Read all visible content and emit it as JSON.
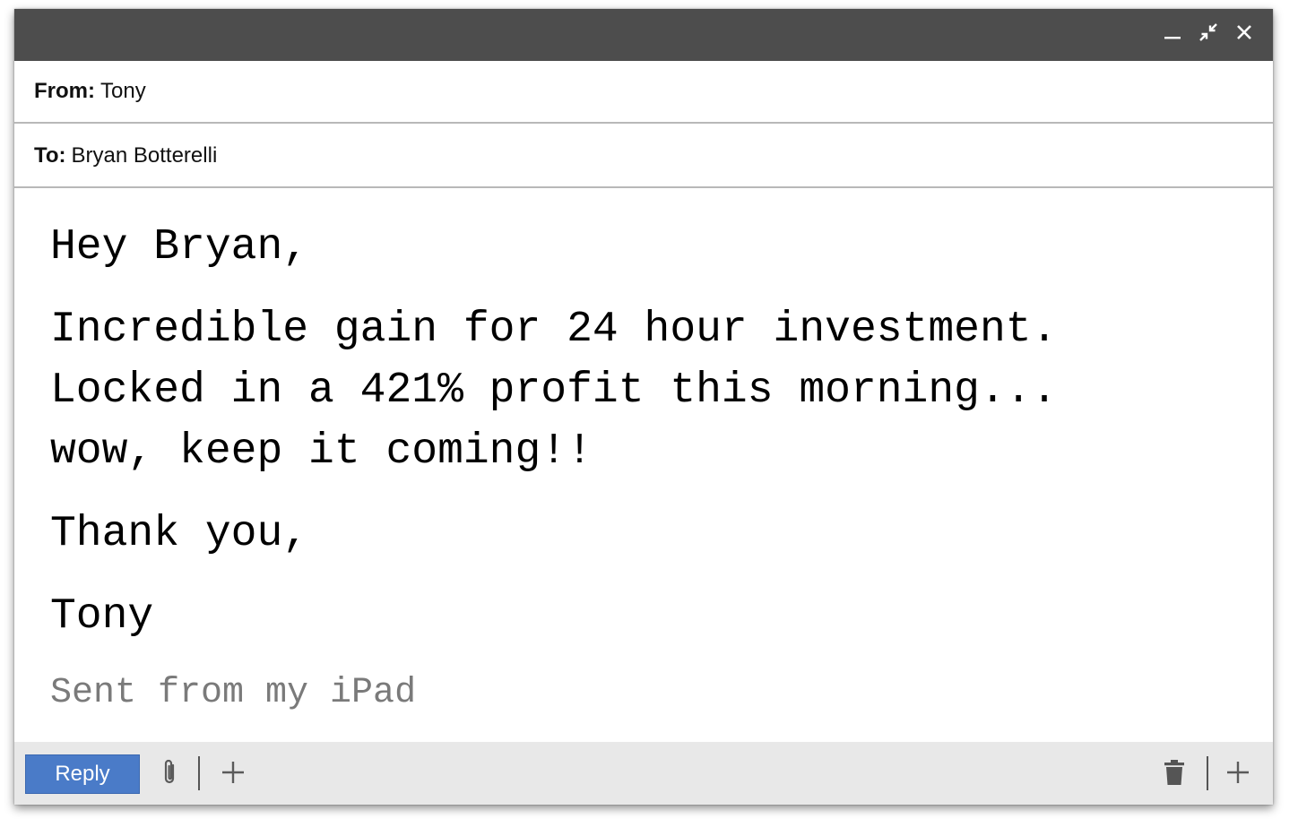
{
  "header": {
    "from_label": "From:",
    "from_value": "Tony",
    "to_label": "To:",
    "to_value": "Bryan Botterelli"
  },
  "message": {
    "greeting": "Hey Bryan,",
    "line1": "Incredible gain for 24 hour investment.",
    "line2": "Locked in a 421% profit this morning...",
    "line3": "wow, keep it coming!!",
    "closing": "Thank you,",
    "signature": "Tony",
    "footer": "Sent from my iPad"
  },
  "toolbar": {
    "reply_label": "Reply"
  },
  "icons": {
    "minimize": "minimize-icon",
    "restore": "restore-icon",
    "close": "close-icon",
    "attach": "paperclip-icon",
    "add": "plus-icon",
    "delete": "trash-icon"
  },
  "colors": {
    "titlebar": "#4d4d4d",
    "reply_button": "#4a7bc8",
    "toolbar": "#e8e8e8",
    "footer_text": "#7a7a7a"
  }
}
